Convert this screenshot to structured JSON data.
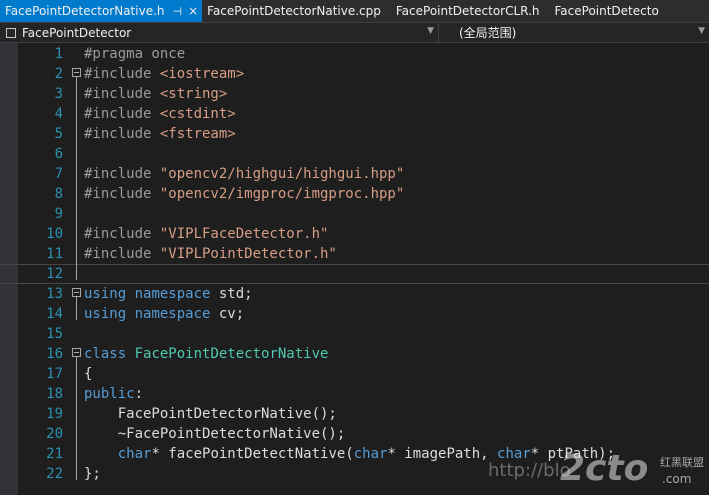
{
  "tabs": [
    {
      "label": "FacePointDetectorNative.h",
      "active": true,
      "pin": "⊣",
      "close": "×"
    },
    {
      "label": "FacePointDetectorNative.cpp",
      "active": false
    },
    {
      "label": "FacePointDetectorCLR.h",
      "active": false
    },
    {
      "label": "FacePointDetecto",
      "active": false
    }
  ],
  "navigation": {
    "scope_left": "FacePointDetector",
    "scope_right": "(全局范围)"
  },
  "editor": {
    "lines": [
      {
        "n": "1",
        "tokens": [
          [
            "pp",
            "#pragma once"
          ]
        ]
      },
      {
        "n": "2",
        "fold": true,
        "tokens": [
          [
            "pp",
            "#include "
          ],
          [
            "str",
            "<iostream>"
          ]
        ]
      },
      {
        "n": "3",
        "tokens": [
          [
            "pp",
            "#include "
          ],
          [
            "str",
            "<string>"
          ]
        ]
      },
      {
        "n": "4",
        "tokens": [
          [
            "pp",
            "#include "
          ],
          [
            "str",
            "<cstdint>"
          ]
        ]
      },
      {
        "n": "5",
        "tokens": [
          [
            "pp",
            "#include "
          ],
          [
            "str",
            "<fstream>"
          ]
        ]
      },
      {
        "n": "6",
        "tokens": []
      },
      {
        "n": "7",
        "tokens": [
          [
            "pp",
            "#include "
          ],
          [
            "str",
            "\"opencv2/highgui/highgui.hpp\""
          ]
        ]
      },
      {
        "n": "8",
        "tokens": [
          [
            "pp",
            "#include "
          ],
          [
            "str",
            "\"opencv2/imgproc/imgproc.hpp\""
          ]
        ]
      },
      {
        "n": "9",
        "tokens": []
      },
      {
        "n": "10",
        "tokens": [
          [
            "pp",
            "#include "
          ],
          [
            "str",
            "\"VIPLFaceDetector.h\""
          ]
        ]
      },
      {
        "n": "11",
        "tokens": [
          [
            "pp",
            "#include "
          ],
          [
            "str",
            "\"VIPLPointDetector.h\""
          ]
        ]
      },
      {
        "n": "12",
        "current": true,
        "tokens": []
      },
      {
        "n": "13",
        "fold": true,
        "tokens": [
          [
            "kw",
            "using"
          ],
          [
            "",
            " "
          ],
          [
            "kw",
            "namespace"
          ],
          [
            "",
            " std;"
          ]
        ]
      },
      {
        "n": "14",
        "tokens": [
          [
            "kw",
            "using"
          ],
          [
            "",
            " "
          ],
          [
            "kw",
            "namespace"
          ],
          [
            "",
            " cv;"
          ]
        ]
      },
      {
        "n": "15",
        "tokens": []
      },
      {
        "n": "16",
        "fold": true,
        "tokens": [
          [
            "kw",
            "class"
          ],
          [
            "",
            " "
          ],
          [
            "typ",
            "FacePointDetectorNative"
          ]
        ]
      },
      {
        "n": "17",
        "tokens": [
          [
            "",
            "{"
          ]
        ]
      },
      {
        "n": "18",
        "tokens": [
          [
            "kw",
            "public"
          ],
          [
            "",
            ":"
          ]
        ]
      },
      {
        "n": "19",
        "tokens": [
          [
            "",
            "    FacePointDetectorNative();"
          ]
        ]
      },
      {
        "n": "20",
        "tokens": [
          [
            "",
            "    ~FacePointDetectorNative();"
          ]
        ]
      },
      {
        "n": "21",
        "tokens": [
          [
            "",
            "    "
          ],
          [
            "kw",
            "char"
          ],
          [
            "",
            "* facePointDetectNative("
          ],
          [
            "kw",
            "char"
          ],
          [
            "",
            "* imagePath, "
          ],
          [
            "kw",
            "char"
          ],
          [
            "",
            "* ptPath);"
          ]
        ]
      },
      {
        "n": "22",
        "tokens": [
          [
            "",
            "};"
          ]
        ]
      }
    ]
  },
  "watermark": {
    "url": "http://blo",
    "logo": "2cto",
    "cn": "红黑联盟",
    "com": ".com"
  },
  "colors": {
    "accent_tab": "#007acc",
    "line_number": "#2b91af",
    "keyword": "#569cd6",
    "preprocessor": "#9b9b9b",
    "string": "#d69d85",
    "type": "#4ec9b0"
  }
}
